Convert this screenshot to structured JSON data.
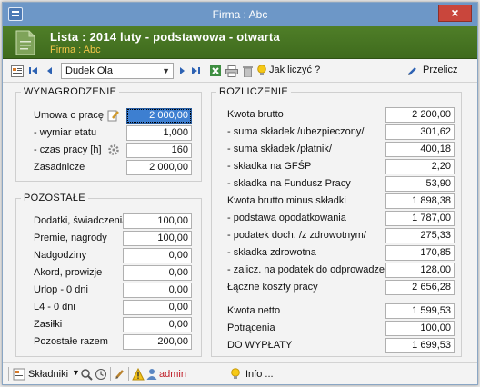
{
  "window": {
    "title": "Firma : Abc",
    "close_label": "×"
  },
  "header": {
    "title": "Lista : 2014 luty - podstawowa - otwarta",
    "subtitle": "Firma : Abc"
  },
  "toolbar": {
    "employee": "Dudek Ola",
    "how_label": "Jak liczyć ?",
    "recalc_label": "Przelicz"
  },
  "wynagrodzenie": {
    "title": "WYNAGRODZENIE",
    "rows": [
      {
        "label": "Umowa o pracę",
        "value": "2 000,00"
      },
      {
        "label": "- wymiar etatu",
        "value": "1,000"
      },
      {
        "label": "- czas pracy [h]",
        "value": "160"
      },
      {
        "label": "Zasadnicze",
        "value": "2 000,00"
      }
    ]
  },
  "pozostale": {
    "title": "POZOSTAŁE",
    "rows": [
      {
        "label": "Dodatki, świadczenia",
        "value": "100,00"
      },
      {
        "label": "Premie, nagrody",
        "value": "100,00"
      },
      {
        "label": "Nadgodziny",
        "value": "0,00"
      },
      {
        "label": "Akord, prowizje",
        "value": "0,00"
      },
      {
        "label": "Urlop - 0 dni",
        "value": "0,00"
      },
      {
        "label": "L4 - 0 dni",
        "value": "0,00"
      },
      {
        "label": "Zasiłki",
        "value": "0,00"
      },
      {
        "label": "Pozostałe razem",
        "value": "200,00"
      }
    ]
  },
  "rozliczenie": {
    "title": "ROZLICZENIE",
    "rows": [
      {
        "label": "Kwota brutto",
        "value": "2 200,00"
      },
      {
        "label": "- suma składek /ubezpieczony/",
        "value": "301,62"
      },
      {
        "label": "- suma składek /płatnik/",
        "value": "400,18"
      },
      {
        "label": "- składka na GFŚP",
        "value": "2,20"
      },
      {
        "label": "- składka na Fundusz Pracy",
        "value": "53,90"
      },
      {
        "label": "Kwota brutto minus składki",
        "value": "1 898,38"
      },
      {
        "label": "- podstawa opodatkowania",
        "value": "1 787,00"
      },
      {
        "label": "- podatek doch. /z zdrowotnym/",
        "value": "275,33"
      },
      {
        "label": "- składka zdrowotna",
        "value": "170,85"
      },
      {
        "label": "- zalicz. na podatek do odprowadzenia",
        "value": "128,00"
      },
      {
        "label": "Łączne koszty pracy",
        "value": "2 656,28"
      },
      {
        "label": "Kwota netto",
        "value": "1 599,53"
      },
      {
        "label": "Potrącenia",
        "value": "100,00"
      },
      {
        "label": "DO WYPŁATY",
        "value": "1 699,53"
      }
    ]
  },
  "status": {
    "skladniki_label": "Składniki",
    "user": "admin",
    "info_label": "Info ..."
  }
}
